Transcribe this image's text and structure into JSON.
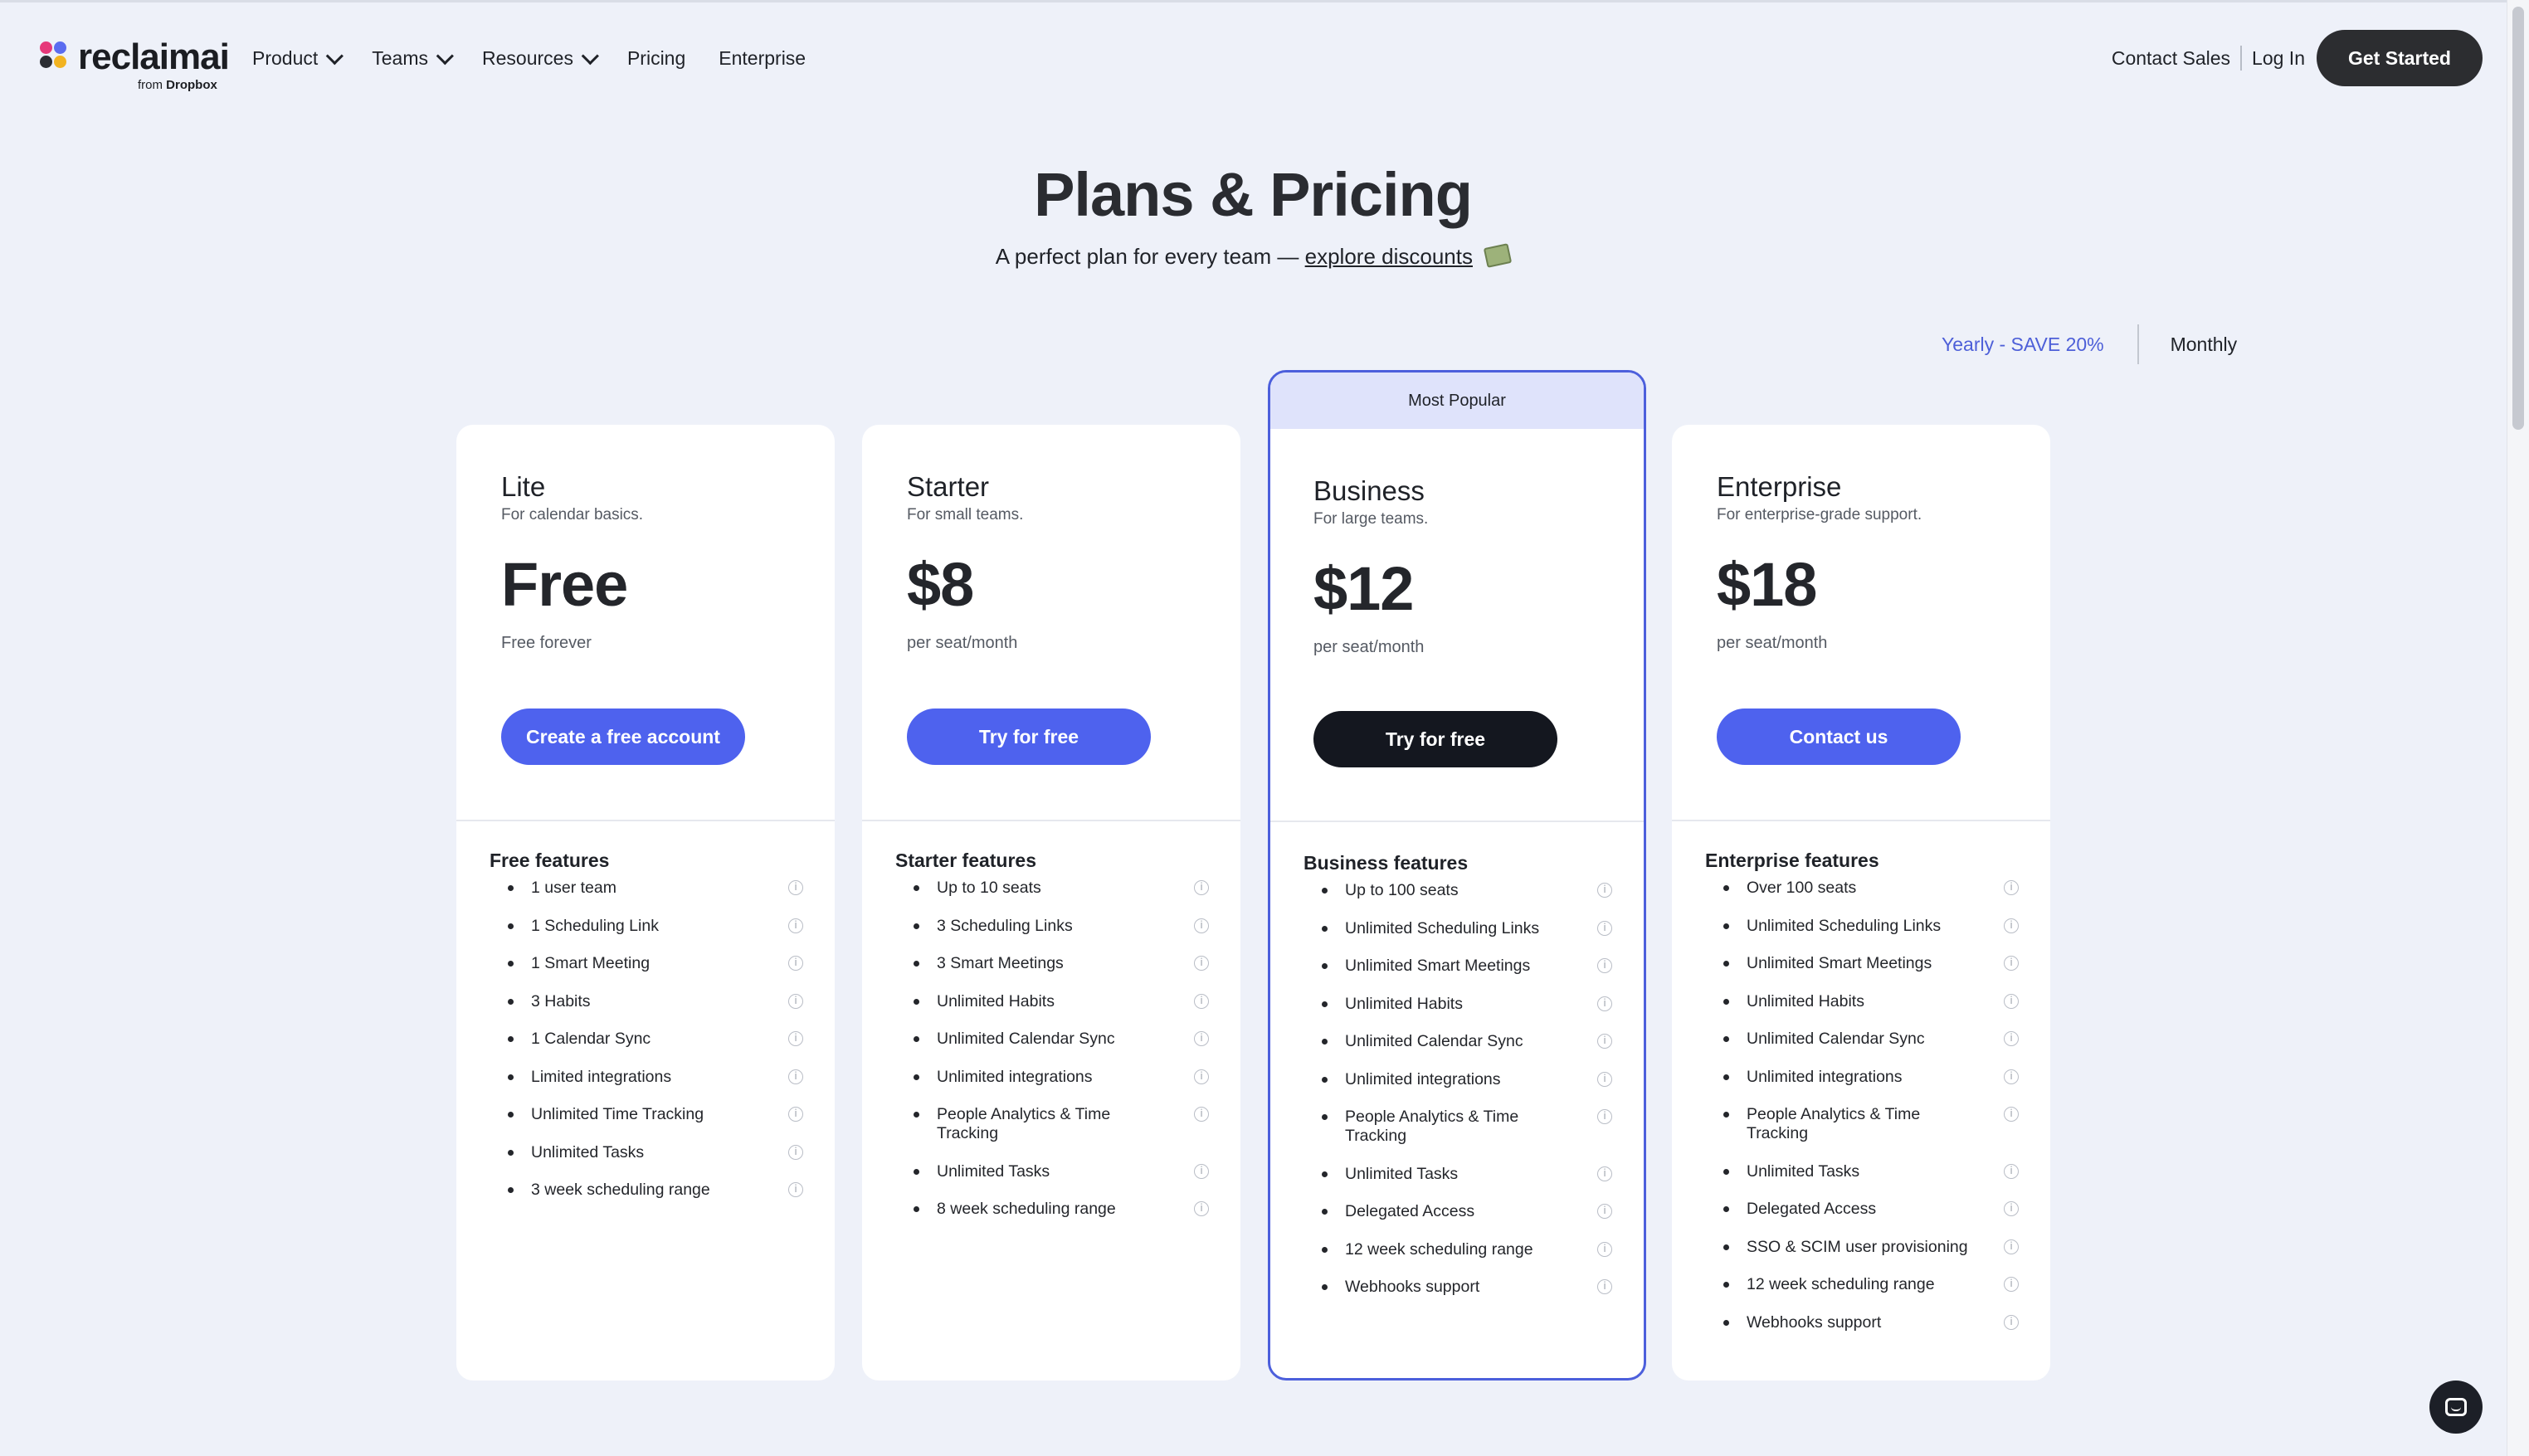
{
  "header": {
    "logo_text": "reclaimai",
    "logo_sub_prefix": "from",
    "logo_sub_brand": "Dropbox",
    "nav": [
      {
        "label": "Product",
        "has_menu": true
      },
      {
        "label": "Teams",
        "has_menu": true
      },
      {
        "label": "Resources",
        "has_menu": true
      },
      {
        "label": "Pricing",
        "has_menu": false
      },
      {
        "label": "Enterprise",
        "has_menu": false
      }
    ],
    "contact_sales": "Contact Sales",
    "log_in": "Log In",
    "get_started": "Get Started"
  },
  "hero": {
    "title": "Plans & Pricing",
    "subtitle_prefix": "A perfect plan for every team —",
    "subtitle_link": "explore discounts",
    "subtitle_icon": "money-icon"
  },
  "billing": {
    "yearly": "Yearly - SAVE 20%",
    "monthly": "Monthly"
  },
  "plans": [
    {
      "name": "Lite",
      "description": "For calendar basics.",
      "price": "Free",
      "period": "Free forever",
      "cta": "Create a free account",
      "features_title": "Free features",
      "features": [
        "1 user team",
        "1 Scheduling Link",
        "1 Smart Meeting",
        "3 Habits",
        "1 Calendar Sync",
        "Limited integrations",
        "Unlimited Time Tracking",
        "Unlimited Tasks",
        "3 week scheduling range"
      ]
    },
    {
      "name": "Starter",
      "description": "For small teams.",
      "price": "$8",
      "period": "per seat/month",
      "cta": "Try for free",
      "features_title": "Starter features",
      "features": [
        "Up to 10 seats",
        "3 Scheduling Links",
        "3 Smart Meetings",
        "Unlimited Habits",
        "Unlimited Calendar Sync",
        "Unlimited integrations",
        "People Analytics & Time Tracking",
        "Unlimited Tasks",
        "8 week scheduling range"
      ]
    },
    {
      "name": "Business",
      "badge": "Most Popular",
      "description": "For large teams.",
      "price": "$12",
      "period": "per seat/month",
      "cta": "Try for free",
      "features_title": "Business features",
      "features": [
        "Up to 100 seats",
        "Unlimited Scheduling Links",
        "Unlimited Smart Meetings",
        "Unlimited Habits",
        "Unlimited Calendar Sync",
        "Unlimited integrations",
        "People Analytics & Time Tracking",
        "Unlimited Tasks",
        "Delegated Access",
        "12 week scheduling range",
        "Webhooks support"
      ]
    },
    {
      "name": "Enterprise",
      "description": "For enterprise-grade support.",
      "price": "$18",
      "period": "per seat/month",
      "cta": "Contact us",
      "features_title": "Enterprise features",
      "features": [
        "Over 100 seats",
        "Unlimited Scheduling Links",
        "Unlimited Smart Meetings",
        "Unlimited Habits",
        "Unlimited Calendar Sync",
        "Unlimited integrations",
        "People Analytics & Time Tracking",
        "Unlimited Tasks",
        "Delegated Access",
        "SSO & SCIM user provisioning",
        "12 week scheduling range",
        "Webhooks support"
      ]
    }
  ],
  "colors": {
    "accent": "#4e62ee",
    "popular_border": "#4c5fdc",
    "popular_band": "#dfe3fb",
    "background": "#eef1f9",
    "dark_button": "#14171f"
  }
}
